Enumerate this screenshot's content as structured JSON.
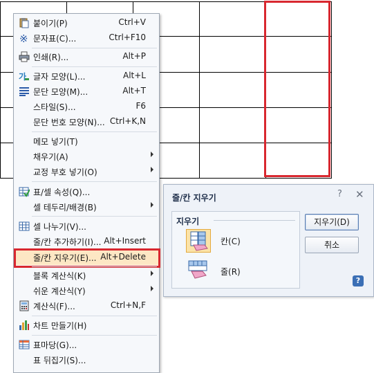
{
  "context_menu": {
    "items": [
      {
        "label": "붙이기(P)",
        "shortcut": "Ctrl+V",
        "icon": "paste-icon"
      },
      {
        "label": "문자표(C)...",
        "shortcut": "Ctrl+F10",
        "icon": "symbol-icon"
      },
      {
        "label": "인쇄(R)...",
        "shortcut": "Alt+P",
        "icon": "print-icon"
      },
      {
        "label": "글자 모양(L)...",
        "shortcut": "Alt+L",
        "icon": "char-shape-icon"
      },
      {
        "label": "문단 모양(M)...",
        "shortcut": "Alt+T",
        "icon": "para-shape-icon"
      },
      {
        "label": "스타일(S)...",
        "shortcut": "F6",
        "icon": ""
      },
      {
        "label": "문단 번호 모양(N)...",
        "shortcut": "Ctrl+K,N",
        "icon": ""
      },
      {
        "label": "메모 넣기(T)",
        "shortcut": "",
        "icon": ""
      },
      {
        "label": "채우기(A)",
        "shortcut": "",
        "icon": "",
        "submenu": true
      },
      {
        "label": "교정 부호 넣기(O)",
        "shortcut": "",
        "icon": "",
        "submenu": true
      },
      {
        "label": "표/셀 속성(Q)...",
        "shortcut": "",
        "icon": "table-props-icon"
      },
      {
        "label": "셀 테두리/배경(B)",
        "shortcut": "",
        "icon": "",
        "submenu": true
      },
      {
        "label": "셀 나누기(V)...",
        "shortcut": "",
        "icon": "split-cell-icon"
      },
      {
        "label": "줄/칸 추가하기(I)...",
        "shortcut": "Alt+Insert",
        "icon": ""
      },
      {
        "label": "줄/칸 지우기(E)...",
        "shortcut": "Alt+Delete",
        "icon": "",
        "highlighted": true
      },
      {
        "label": "블록 계산식(K)",
        "shortcut": "",
        "icon": "",
        "submenu": true
      },
      {
        "label": "쉬운 계산식(Y)",
        "shortcut": "",
        "icon": "",
        "submenu": true
      },
      {
        "label": "계산식(F)...",
        "shortcut": "Ctrl+N,F",
        "icon": "formula-icon"
      },
      {
        "label": "차트 만들기(H)",
        "shortcut": "",
        "icon": "chart-icon"
      },
      {
        "label": "표마당(G)...",
        "shortcut": "",
        "icon": "table-gallery-icon"
      },
      {
        "label": "표 뒤집기(S)...",
        "shortcut": "",
        "icon": ""
      }
    ]
  },
  "dialog": {
    "title": "줄/칸 지우기",
    "help_glyph": "?",
    "close_glyph": "✕",
    "group_title": "지우기",
    "options": [
      {
        "label": "칸(C)",
        "icon": "delete-column-icon",
        "selected": true
      },
      {
        "label": "줄(R)",
        "icon": "delete-row-icon",
        "selected": false
      }
    ],
    "buttons": {
      "ok": "지우기(D)",
      "cancel": "취소"
    },
    "help_button": "?"
  },
  "colors": {
    "highlight": "#d8272f",
    "menu_bg": "#f6f8fb",
    "dialog_bg": "#eef2f8",
    "hover": "#fde7c4"
  }
}
